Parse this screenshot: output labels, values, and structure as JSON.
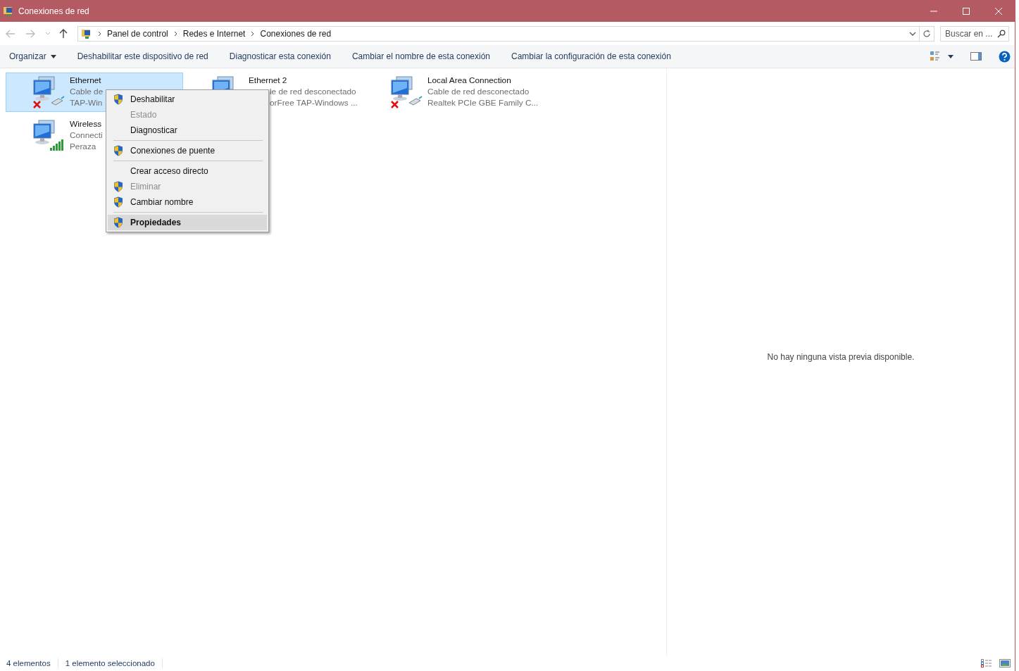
{
  "window": {
    "title": "Conexiones de red"
  },
  "address_bar": {
    "breadcrumbs": [
      "Panel de control",
      "Redes e Internet",
      "Conexiones de red"
    ],
    "search": {
      "placeholder": "Buscar en ..."
    }
  },
  "toolbar": {
    "items": [
      {
        "label": "Organizar",
        "kind": "menu"
      },
      {
        "label": "Deshabilitar este dispositivo de red",
        "kind": "command"
      },
      {
        "label": "Diagnosticar esta conexión",
        "kind": "command"
      },
      {
        "label": "Cambiar el nombre de esta conexión",
        "kind": "command"
      },
      {
        "label": "Cambiar la configuración de esta conexión",
        "kind": "command"
      }
    ]
  },
  "connections": [
    {
      "name": "Ethernet",
      "status": "Cable de",
      "device": "TAP-Win",
      "selected": true,
      "kind": "wired",
      "disconnected": true
    },
    {
      "name": "Ethernet 2",
      "status": "le de red desconectado",
      "device": "orFree TAP-Windows ...",
      "selected": false,
      "kind": "wired"
    },
    {
      "name": "Local Area Connection",
      "status": "Cable de red desconectado",
      "device": "Realtek PCIe GBE Family C...",
      "selected": false,
      "kind": "wired",
      "disconnected": true
    },
    {
      "name": "Wireless",
      "status": "Connecti",
      "device": "Peraza",
      "selected": false,
      "kind": "wireless",
      "disconnected": false
    }
  ],
  "context_menu": {
    "items": [
      {
        "kind": "item",
        "label": "Deshabilitar",
        "shield": true,
        "disabled": false,
        "default": false,
        "selected": false
      },
      {
        "kind": "item",
        "label": "Estado",
        "shield": false,
        "disabled": true,
        "default": false,
        "selected": false
      },
      {
        "kind": "item",
        "label": "Diagnosticar",
        "shield": false,
        "disabled": false,
        "default": false,
        "selected": false
      },
      {
        "kind": "separator"
      },
      {
        "kind": "item",
        "label": "Conexiones de puente",
        "shield": true,
        "disabled": false,
        "default": false,
        "selected": false
      },
      {
        "kind": "separator"
      },
      {
        "kind": "item",
        "label": "Crear acceso directo",
        "shield": false,
        "disabled": false,
        "default": false,
        "selected": false
      },
      {
        "kind": "item",
        "label": "Eliminar",
        "shield": true,
        "disabled": true,
        "default": false,
        "selected": false
      },
      {
        "kind": "item",
        "label": "Cambiar nombre",
        "shield": true,
        "disabled": false,
        "default": false,
        "selected": false
      },
      {
        "kind": "separator"
      },
      {
        "kind": "item",
        "label": "Propiedades",
        "shield": true,
        "disabled": false,
        "default": true,
        "selected": true
      }
    ]
  },
  "preview_pane": {
    "message": "No hay ninguna vista previa disponible."
  },
  "status_bar": {
    "count": "4 elementos",
    "selection": "1 elemento seleccionado"
  }
}
